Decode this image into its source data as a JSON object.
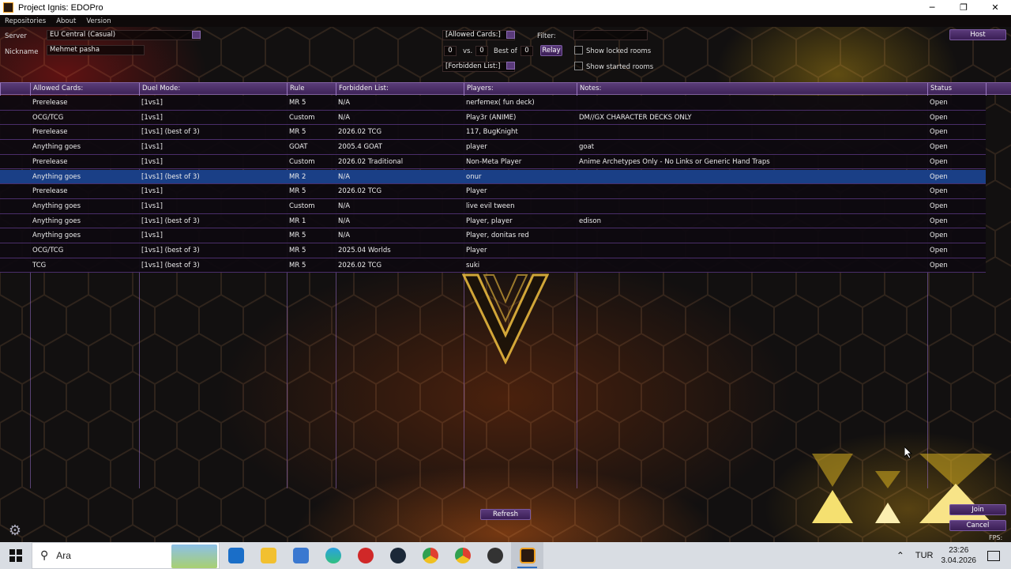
{
  "window": {
    "title": "Project Ignis: EDOPro",
    "minimize": "─",
    "maximize": "❐",
    "close": "✕"
  },
  "menu": {
    "items": [
      "Repositories",
      "About",
      "Version"
    ]
  },
  "top": {
    "server_label": "Server",
    "server_value": "EU Central (Casual)",
    "nickname_label": "Nickname",
    "nickname_value": "Mehmet pasha",
    "allowed_cards_value": "[Allowed Cards:]",
    "forbidden_list_value": "[Forbidden List:]",
    "team1_count": "0",
    "vs_label": "vs.",
    "team2_count": "0",
    "best_of_label": "Best of",
    "best_of_value": "0",
    "relay_label": "Relay",
    "filter_label": "Filter:",
    "filter_value": "",
    "show_locked_label": "Show locked rooms",
    "show_started_label": "Show started rooms",
    "host_label": "Host"
  },
  "table": {
    "headers": [
      "Allowed Cards:",
      "Duel Mode:",
      "Rule",
      "Forbidden List:",
      "Players:",
      "Notes:",
      "Status"
    ],
    "rows": [
      [
        "Prerelease",
        "[1vs1]",
        "MR 5",
        "N/A",
        "nerfemex( fun deck)",
        "",
        "Open"
      ],
      [
        "OCG/TCG",
        "[1vs1]",
        "Custom",
        "N/A",
        "Play3r (ANIME)",
        "DM//GX CHARACTER DECKS ONLY",
        "Open"
      ],
      [
        "Prerelease",
        "[1vs1] (best of 3)",
        "MR 5",
        "2026.02 TCG",
        "117, BugKnight",
        "",
        "Open"
      ],
      [
        "Anything goes",
        "[1vs1]",
        "GOAT",
        "2005.4 GOAT",
        "player",
        "goat",
        "Open"
      ],
      [
        "Prerelease",
        "[1vs1]",
        "Custom",
        "2026.02 Traditional",
        "Non-Meta Player",
        "Anime Archetypes Only - No Links or Generic Hand Traps",
        "Open"
      ],
      [
        "Anything goes",
        "[1vs1] (best of 3)",
        "MR 2",
        "N/A",
        "onur",
        "",
        "Open"
      ],
      [
        "Prerelease",
        "[1vs1]",
        "MR 5",
        "2026.02 TCG",
        "Player",
        "",
        "Open"
      ],
      [
        "Anything goes",
        "[1vs1]",
        "Custom",
        "N/A",
        "live evil tween",
        "",
        "Open"
      ],
      [
        "Anything goes",
        "[1vs1] (best of 3)",
        "MR 1",
        "N/A",
        "Player, player",
        "edison",
        "Open"
      ],
      [
        "Anything goes",
        "[1vs1]",
        "MR 5",
        "N/A",
        "Player, donitas red",
        "",
        "Open"
      ],
      [
        "OCG/TCG",
        "[1vs1] (best of 3)",
        "MR 5",
        "2025.04 Worlds",
        "Player",
        "",
        "Open"
      ],
      [
        "TCG",
        "[1vs1] (best of 3)",
        "MR 5",
        "2026.02 TCG",
        "suki",
        "",
        "Open"
      ]
    ],
    "selected_row": 5
  },
  "bottom": {
    "refresh_label": "Refresh",
    "join_label": "Join",
    "cancel_label": "Cancel",
    "fps_label": "FPS: 50"
  },
  "taskbar": {
    "search_placeholder": "Ara",
    "language": "TUR",
    "time": "23:26",
    "date": "3.04.2026",
    "apps": [
      "outlook-icon",
      "file-explorer-icon",
      "store-icon",
      "edge-icon",
      "redapp-icon",
      "steam-icon",
      "chrome-icon",
      "chrome-alt-icon",
      "obs-icon",
      "edopro-icon"
    ]
  },
  "colors": {
    "header_purple": "#4a2c68",
    "selected_blue": "#1a3f86",
    "accent_gold": "#f0c020"
  }
}
